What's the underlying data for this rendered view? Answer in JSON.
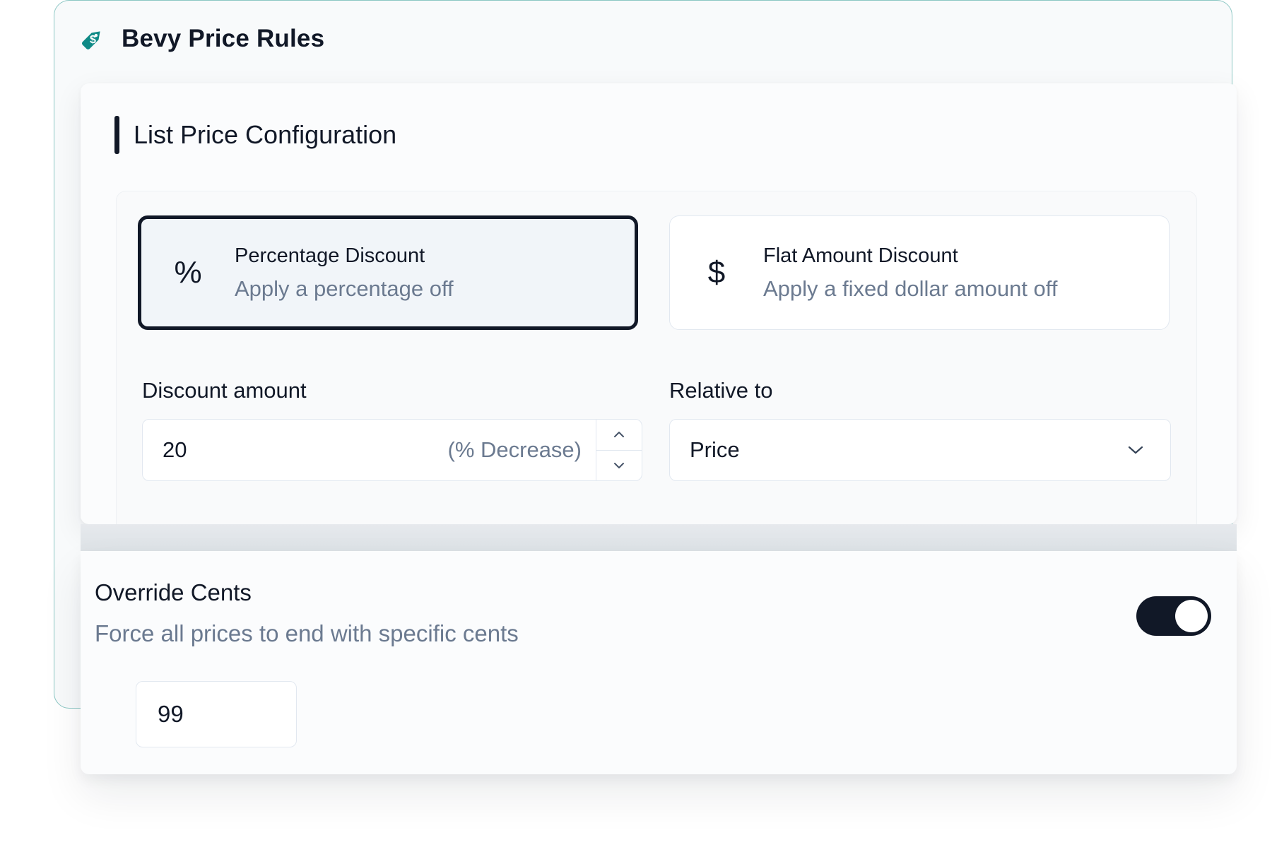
{
  "header": {
    "title": "Bevy Price Rules",
    "logo_icon": "price-tag-icon",
    "accent_color": "#0f8a86"
  },
  "list_price": {
    "section_title": "List Price Configuration",
    "options": [
      {
        "icon": "percent-icon",
        "icon_glyph": "%",
        "title": "Percentage Discount",
        "subtitle": "Apply a percentage off",
        "selected": true
      },
      {
        "icon": "dollar-icon",
        "icon_glyph": "$",
        "title": "Flat Amount Discount",
        "subtitle": "Apply a fixed dollar amount off",
        "selected": false
      }
    ],
    "discount_amount": {
      "label": "Discount amount",
      "value": "20",
      "suffix": "(% Decrease)"
    },
    "relative_to": {
      "label": "Relative to",
      "selected": "Price"
    }
  },
  "override_cents": {
    "title": "Override Cents",
    "description": "Force all prices to end with specific cents",
    "enabled": true,
    "value": "99"
  }
}
